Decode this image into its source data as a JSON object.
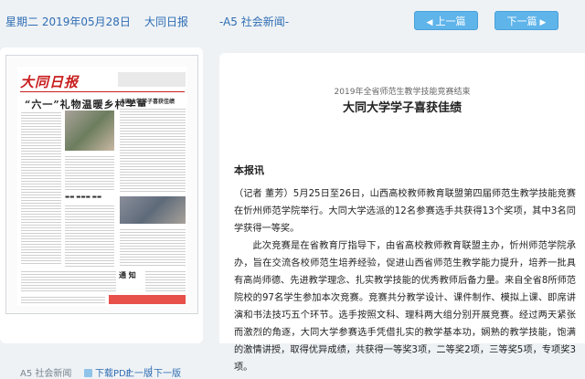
{
  "topbar": {
    "date": "星期二 2019年05月28日",
    "paper": "大同日报",
    "section": "-A5 社会新闻-",
    "prev_label": "上一篇",
    "next_label": "下一篇"
  },
  "thumbnail": {
    "masthead": "大同日报",
    "headline": "“六一”礼物温暖乡村学童",
    "side_headline": "大同大学学子喜获佳绩",
    "box_title": "通 知"
  },
  "left_footer": {
    "page": "A5 社会新闻",
    "pdf": "下载PDF",
    "prev_page": "上一版",
    "separator": "|",
    "next_page": "下一版"
  },
  "article": {
    "subtitle": "2019年全省师范生教学技能竞赛结束",
    "title": "大同大学学子喜获佳绩",
    "source": "本报讯",
    "paragraphs": [
      "（记者 董芳）5月25日至26日，山西高校教师教育联盟第四届师范生教学技能竞赛在忻州师范学院举行。大同大学选派的12名参赛选手共获得13个奖项，其中3名同学获得一等奖。",
      "此次竞赛是在省教育厅指导下，由省高校教师教育联盟主办，忻州师范学院承办，旨在交流各校师范生培养经验，促进山西省师范生教学能力提升，培养一批具有高尚师德、先进教学理念、扎实教学技能的优秀教师后备力量。来自全省8所师范院校的97名学生参加本次竞赛。竞赛共分教学设计、课件制作、模拟上课、即席讲演和书法技巧五个环节。选手按照文科、理科两大组分别开展竞赛。经过两天紧张而激烈的角逐，大同大学参赛选手凭借扎实的教学基本功，娴熟的教学技能，饱满的激情讲授，取得优异成绩，共获得一等奖3项，二等奖2项，三等奖5项，专项奖3项。"
    ]
  },
  "colors": {
    "link": "#2f6db3",
    "button": "#5fb4ea",
    "background": "#eef2f5"
  }
}
